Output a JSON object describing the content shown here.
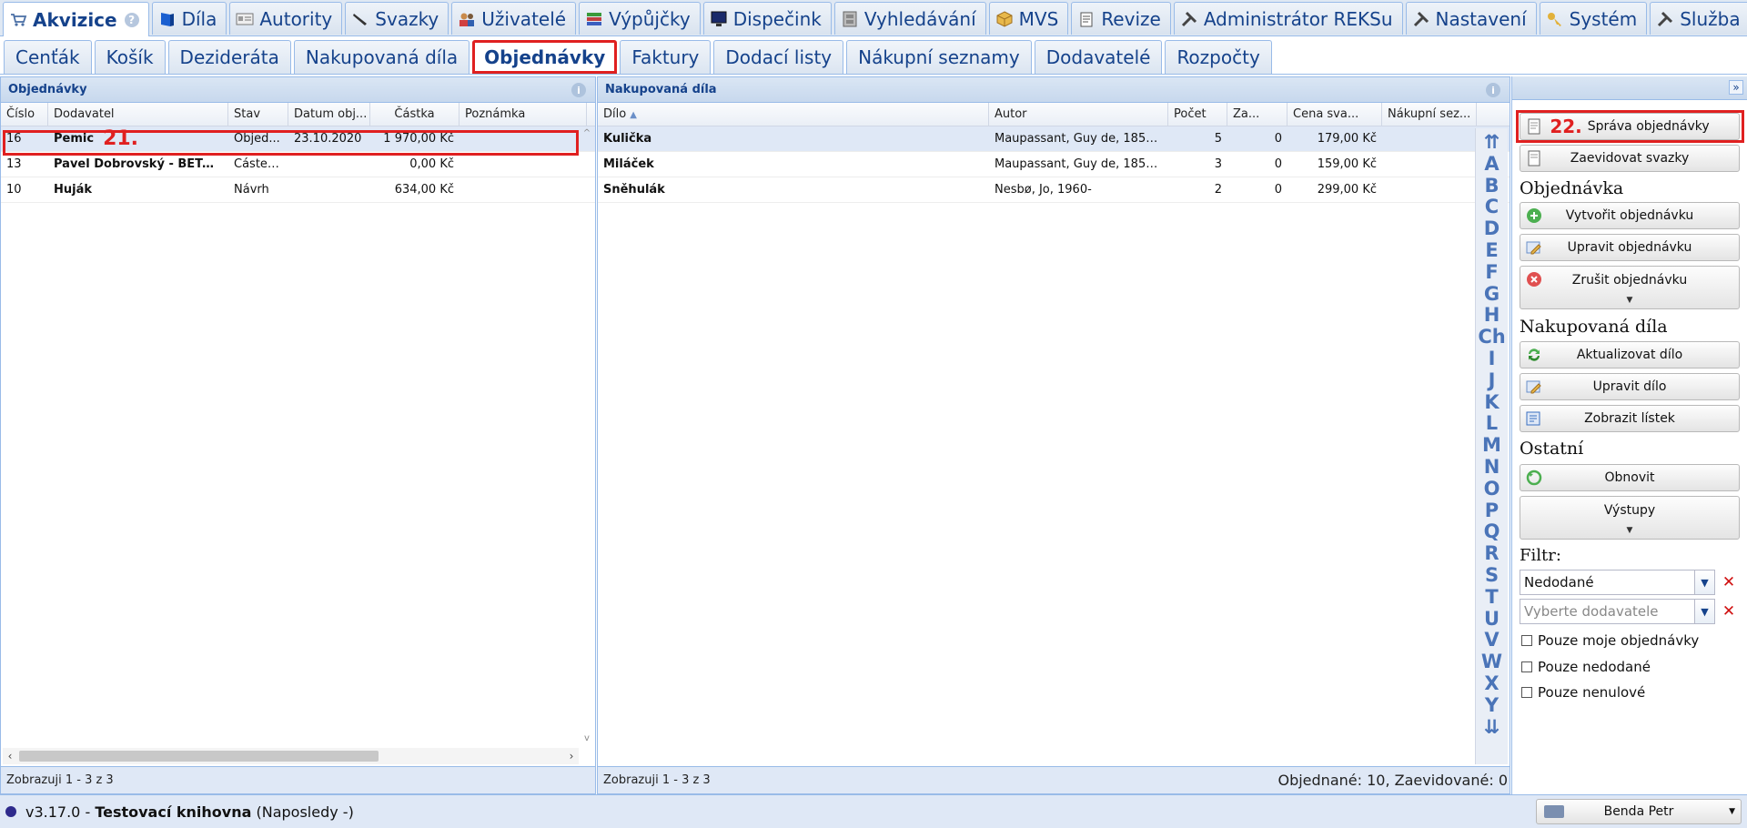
{
  "main_tabs": [
    {
      "label": "Akvizice",
      "icon": "cart-icon",
      "active": true
    },
    {
      "label": "Díla",
      "icon": "book-icon"
    },
    {
      "label": "Autority",
      "icon": "card-icon"
    },
    {
      "label": "Svazky",
      "icon": "pen-icon"
    },
    {
      "label": "Uživatelé",
      "icon": "users-icon"
    },
    {
      "label": "Výpůjčky",
      "icon": "books-icon"
    },
    {
      "label": "Dispečink",
      "icon": "monitor-icon"
    },
    {
      "label": "Vyhledávání",
      "icon": "search-cabinet-icon"
    },
    {
      "label": "MVS",
      "icon": "package-icon"
    },
    {
      "label": "Revize",
      "icon": "clipboard-icon"
    },
    {
      "label": "Administrátor REKSu",
      "icon": "tools-icon"
    },
    {
      "label": "Nastavení",
      "icon": "tools-icon"
    },
    {
      "label": "Systém",
      "icon": "key-icon"
    },
    {
      "label": "Služba",
      "icon": "tools-icon"
    }
  ],
  "sub_tabs": [
    {
      "label": "Cenťák"
    },
    {
      "label": "Košík"
    },
    {
      "label": "Dezideráta"
    },
    {
      "label": "Nakupovaná díla"
    },
    {
      "label": "Objednávky",
      "active": true
    },
    {
      "label": "Faktury"
    },
    {
      "label": "Dodací listy"
    },
    {
      "label": "Nákupní seznamy"
    },
    {
      "label": "Dodavatelé"
    },
    {
      "label": "Rozpočty"
    }
  ],
  "orders_panel": {
    "title": "Objednávky",
    "columns": [
      "Číslo",
      "Dodavatel",
      "Stav",
      "Datum obj...",
      "Částka",
      "Poznámka"
    ],
    "rows": [
      {
        "cislo": "16",
        "dodavatel": "Pemic",
        "stav": "Objed...",
        "datum": "23.10.2020",
        "castka": "1 970,00 Kč",
        "poznamka": ""
      },
      {
        "cislo": "13",
        "dodavatel": "Pavel Dobrovský - BETA ...",
        "stav": "Částeč...",
        "datum": "",
        "castka": "0,00 Kč",
        "poznamka": ""
      },
      {
        "cislo": "10",
        "dodavatel": "Huják",
        "stav": "Návrh",
        "datum": "",
        "castka": "634,00 Kč",
        "poznamka": ""
      }
    ],
    "footer": "Zobrazuji 1 - 3 z 3",
    "marker": "21."
  },
  "works_panel": {
    "title": "Nakupovaná díla",
    "columns": [
      "Dílo",
      "Autor",
      "Počet",
      "Za...",
      "Cena sva...",
      "Nákupní sez..."
    ],
    "rows": [
      {
        "dilo": "Kulička",
        "autor": "Maupassant, Guy de, 1850-...",
        "pocet": "5",
        "za": "0",
        "cena": "179,00 Kč",
        "nakupni": ""
      },
      {
        "dilo": "Miláček",
        "autor": "Maupassant, Guy de, 1850-...",
        "pocet": "3",
        "za": "0",
        "cena": "159,00 Kč",
        "nakupni": ""
      },
      {
        "dilo": "Sněhulák",
        "autor": "Nesbø, Jo, 1960-",
        "pocet": "2",
        "za": "0",
        "cena": "299,00 Kč",
        "nakupni": ""
      }
    ],
    "footer_left": "Zobrazuji 1 - 3 z 3",
    "footer_right": "Objednané: 10, Zaevidované: 0",
    "alphabet": [
      "A",
      "B",
      "C",
      "D",
      "E",
      "F",
      "G",
      "H",
      "Ch",
      "I",
      "J",
      "K",
      "L",
      "M",
      "N",
      "O",
      "P",
      "Q",
      "R",
      "S",
      "T",
      "U",
      "V",
      "W",
      "X",
      "Y"
    ]
  },
  "actions": {
    "marker": "22.",
    "sprava": "Správa objednávky",
    "zaevidovat": "Zaevidovat svazky",
    "sec_objednavka": "Objednávka",
    "vytvorit": "Vytvořit objednávku",
    "upravit_obj": "Upravit objednávku",
    "zrusit": "Zrušit objednávku",
    "sec_dila": "Nakupovaná díla",
    "aktualizovat": "Aktualizovat dílo",
    "upravit_dilo": "Upravit dílo",
    "listek": "Zobrazit lístek",
    "sec_ostatni": "Ostatní",
    "obnovit": "Obnovit",
    "vystupy": "Výstupy",
    "filtr_label": "Filtr:",
    "filtr_value": "Nedodané",
    "dodavatel_placeholder": "Vyberte dodavatele",
    "chk_moje": "Pouze moje objednávky",
    "chk_nedodane": "Pouze nedodané",
    "chk_nenulove": "Pouze nenulové"
  },
  "status": {
    "version": "v3.17.0 - ",
    "library": "Testovací knihovna",
    "last": " (Naposledy -)",
    "user": "Benda Petr"
  },
  "colors": {
    "accent": "#15428b",
    "highlight": "#e02020",
    "selected_row": "#dfe8f6"
  }
}
